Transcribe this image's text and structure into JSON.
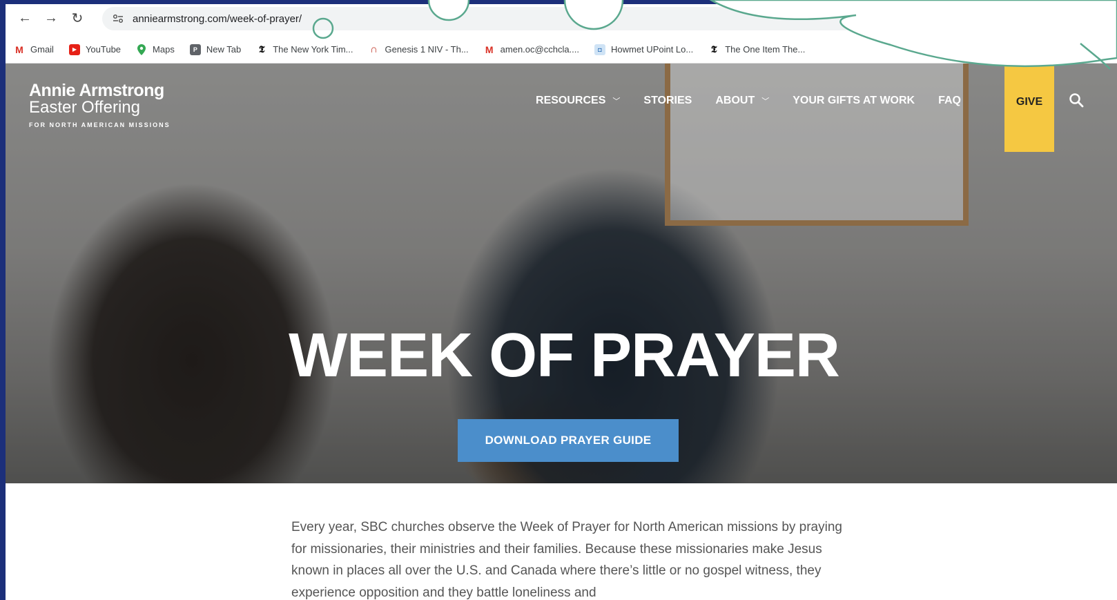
{
  "browser": {
    "url": "anniearmstrong.com/week-of-prayer/",
    "back_icon": "←",
    "forward_icon": "→",
    "reload_icon": "↻"
  },
  "bookmarks": [
    {
      "label": "Gmail",
      "icon": "gmail-icon"
    },
    {
      "label": "YouTube",
      "icon": "youtube-icon"
    },
    {
      "label": "Maps",
      "icon": "maps-icon"
    },
    {
      "label": "New Tab",
      "icon": "new-tab-icon"
    },
    {
      "label": "The New York Tim...",
      "icon": "nyt-icon"
    },
    {
      "label": "Genesis 1 NIV - Th...",
      "icon": "bible-icon"
    },
    {
      "label": "amen.oc@cchcla....",
      "icon": "gmail-icon"
    },
    {
      "label": "Howmet UPoint Lo...",
      "icon": "howmet-icon"
    },
    {
      "label": "The One Item The...",
      "icon": "nyt-icon"
    }
  ],
  "site": {
    "logo_line1": "Annie Armstrong",
    "logo_line2": "Easter Offering",
    "logo_tagline": "FOR NORTH AMERICAN MISSIONS",
    "nav": {
      "resources": "RESOURCES",
      "stories": "STORIES",
      "about": "ABOUT",
      "gifts": "YOUR GIFTS AT WORK",
      "faq": "FAQ",
      "give": "GIVE"
    },
    "headline": "WEEK OF PRAYER",
    "cta": "DOWNLOAD PRAYER GUIDE",
    "intro": "Every year, SBC churches observe the Week of Prayer for North American missions by praying for missionaries, their ministries and their families. Because these missionaries make Jesus known in places all over the U.S. and Canada where there’s little or no gospel witness, they experience opposition and they battle loneliness and"
  },
  "colors": {
    "give_bg": "#f5c842",
    "cta_bg": "#4b8ecb",
    "annotation": "#5aa88e",
    "outer_bg": "#1c2f7a"
  }
}
